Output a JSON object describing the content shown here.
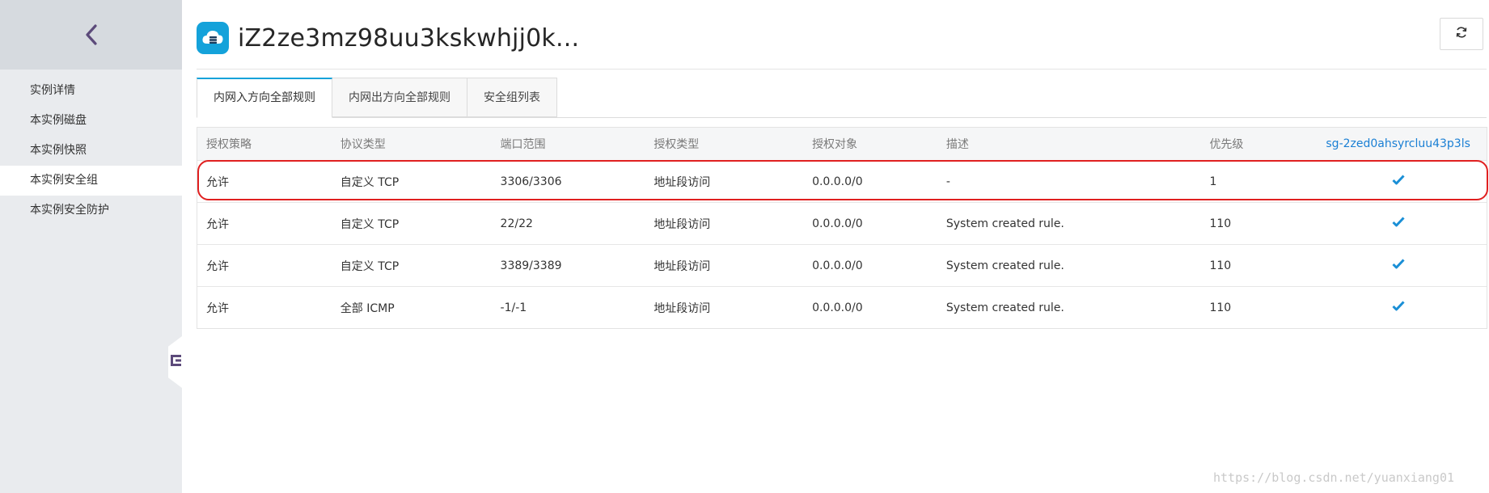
{
  "sidebar": {
    "back_icon": "chevron-left-icon",
    "items": [
      {
        "label": "实例详情",
        "active": false
      },
      {
        "label": "本实例磁盘",
        "active": false
      },
      {
        "label": "本实例快照",
        "active": false
      },
      {
        "label": "本实例安全组",
        "active": true
      },
      {
        "label": "本实例安全防护",
        "active": false
      }
    ],
    "toggle_icon": "collapse-sidebar-icon"
  },
  "header": {
    "icon": "cloud-server-icon",
    "title": "iZ2ze3mz98uu3kskwhjj0k...",
    "refresh_icon": "refresh-icon"
  },
  "tabs": [
    {
      "label": "内网入方向全部规则",
      "active": true
    },
    {
      "label": "内网出方向全部规则",
      "active": false
    },
    {
      "label": "安全组列表",
      "active": false
    }
  ],
  "table": {
    "columns": [
      "授权策略",
      "协议类型",
      "端口范围",
      "授权类型",
      "授权对象",
      "描述",
      "优先级",
      "sg-2zed0ahsyrcluu43p3ls"
    ],
    "rows": [
      {
        "policy": "允许",
        "protocol": "自定义 TCP",
        "port": "3306/3306",
        "auth_type": "地址段访问",
        "target": "0.0.0.0/0",
        "description": "-",
        "priority": "1",
        "checked": true,
        "highlighted": true
      },
      {
        "policy": "允许",
        "protocol": "自定义 TCP",
        "port": "22/22",
        "auth_type": "地址段访问",
        "target": "0.0.0.0/0",
        "description": "System created rule.",
        "priority": "110",
        "checked": true,
        "highlighted": false
      },
      {
        "policy": "允许",
        "protocol": "自定义 TCP",
        "port": "3389/3389",
        "auth_type": "地址段访问",
        "target": "0.0.0.0/0",
        "description": "System created rule.",
        "priority": "110",
        "checked": true,
        "highlighted": false
      },
      {
        "policy": "允许",
        "protocol": "全部 ICMP",
        "port": "-1/-1",
        "auth_type": "地址段访问",
        "target": "0.0.0.0/0",
        "description": "System created rule.",
        "priority": "110",
        "checked": true,
        "highlighted": false
      }
    ]
  },
  "watermark": "https://blog.csdn.net/yuanxiang01",
  "colors": {
    "accent": "#14a2da",
    "link": "#1a7fd4",
    "highlight": "#e02020",
    "sidebar_bg": "#e9ebee"
  }
}
